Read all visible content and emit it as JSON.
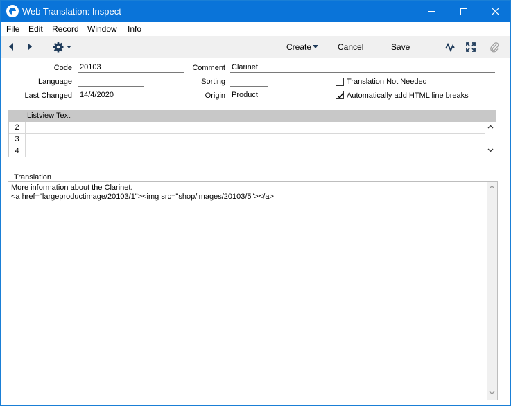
{
  "window": {
    "title": "Web Translation: Inspect"
  },
  "menu": {
    "items": [
      "File",
      "Edit",
      "Record",
      "Window",
      "Info"
    ]
  },
  "toolbar": {
    "create": "Create",
    "cancel": "Cancel",
    "save": "Save"
  },
  "form": {
    "code_label": "Code",
    "code_value": "20103",
    "comment_label": "Comment",
    "comment_value": "Clarinet",
    "language_label": "Language",
    "language_value": "",
    "sorting_label": "Sorting",
    "sorting_value": "",
    "last_changed_label": "Last Changed",
    "last_changed_value": "14/4/2020",
    "origin_label": "Origin",
    "origin_value": "Product",
    "translation_not_needed_label": "Translation Not Needed",
    "translation_not_needed_checked": false,
    "auto_html_label": "Automatically add HTML line breaks",
    "auto_html_checked": true
  },
  "listview": {
    "header": "Listview Text",
    "rows": [
      {
        "num": "2",
        "text": ""
      },
      {
        "num": "3",
        "text": ""
      },
      {
        "num": "4",
        "text": ""
      }
    ]
  },
  "translation": {
    "label": "Translation",
    "text": "More information about the Clarinet.\n<a href=\"largeproductimage/20103/1\"><img src=\"shop/images/20103/5\"></a>"
  }
}
